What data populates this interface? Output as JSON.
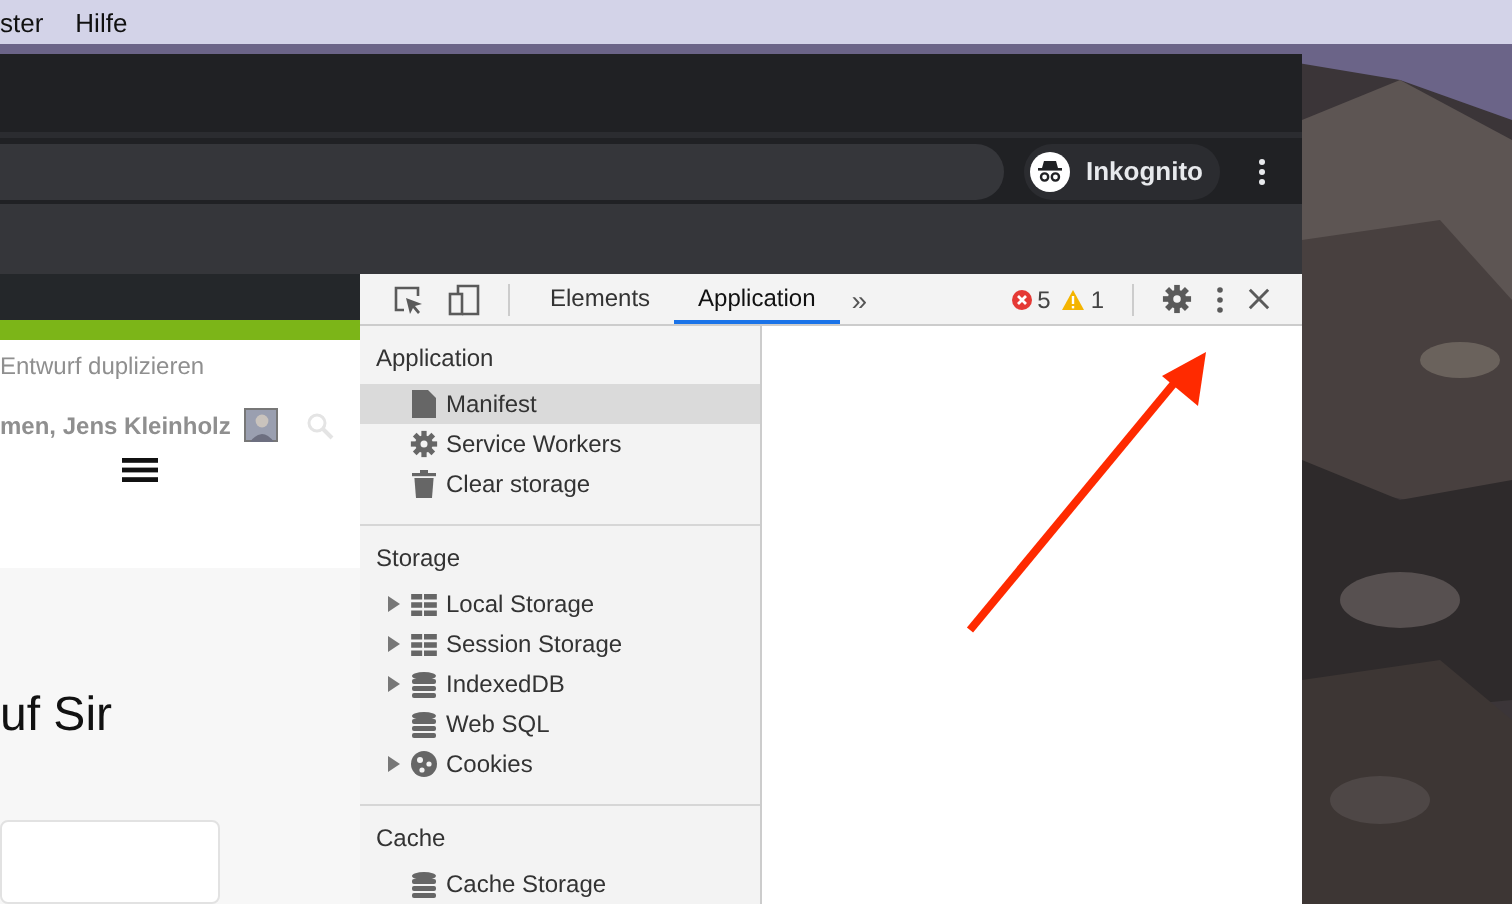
{
  "menubar": {
    "items": [
      "ster",
      "Hilfe"
    ]
  },
  "browser": {
    "incognito_label": "Inkognito"
  },
  "webpage": {
    "header_links": [
      "Entwurf duplizieren"
    ],
    "author_line": "men, Jens Kleinholz",
    "heading": "uf Sir"
  },
  "devtools": {
    "tabs": [
      {
        "label": "Elements",
        "selected": false
      },
      {
        "label": "Application",
        "selected": true
      }
    ],
    "more_tabs": "»",
    "error_count": "5",
    "warning_count": "1",
    "sections": [
      {
        "title": "Application",
        "items": [
          {
            "label": "Manifest",
            "kind": "file",
            "expandable": false,
            "selected": true
          },
          {
            "label": "Service Workers",
            "kind": "gear",
            "expandable": false,
            "selected": false
          },
          {
            "label": "Clear storage",
            "kind": "trash",
            "expandable": false,
            "selected": false
          }
        ]
      },
      {
        "title": "Storage",
        "items": [
          {
            "label": "Local Storage",
            "kind": "table",
            "expandable": true,
            "selected": false
          },
          {
            "label": "Session Storage",
            "kind": "table",
            "expandable": true,
            "selected": false
          },
          {
            "label": "IndexedDB",
            "kind": "database",
            "expandable": true,
            "selected": false
          },
          {
            "label": "Web SQL",
            "kind": "database",
            "expandable": false,
            "selected": false
          },
          {
            "label": "Cookies",
            "kind": "cookie",
            "expandable": true,
            "selected": false
          }
        ]
      },
      {
        "title": "Cache",
        "items": [
          {
            "label": "Cache Storage",
            "kind": "database",
            "expandable": false,
            "selected": false
          }
        ]
      }
    ]
  }
}
